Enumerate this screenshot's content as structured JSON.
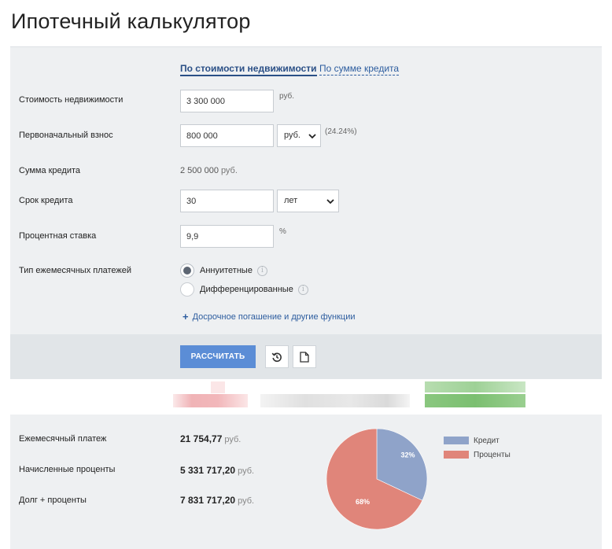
{
  "title": "Ипотечный калькулятор",
  "mode_tabs": {
    "by_property": "По стоимости недвижимости",
    "by_loan": "По сумме кредита"
  },
  "form": {
    "property_cost": {
      "label": "Стоимость недвижимости",
      "value": "3 300 000",
      "unit": "руб."
    },
    "down_payment": {
      "label": "Первоначальный взнос",
      "value": "800 000",
      "unit_selected": "руб.",
      "percent": "(24.24%)"
    },
    "loan_amount": {
      "label": "Сумма кредита",
      "value": "2 500 000",
      "unit": "руб."
    },
    "term": {
      "label": "Срок кредита",
      "value": "30",
      "unit_selected": "лет"
    },
    "rate": {
      "label": "Процентная ставка",
      "value": "9,9",
      "unit": "%"
    },
    "payment_type": {
      "label": "Тип ежемесячных платежей",
      "options": [
        "Аннуитетные",
        "Дифференцированные"
      ],
      "selected": "Аннуитетные"
    },
    "more_link": "Досрочное погашение и другие функции"
  },
  "actions": {
    "calculate": "РАССЧИТАТЬ",
    "reset_icon": "history-icon",
    "document_icon": "document-icon"
  },
  "results": {
    "monthly": {
      "label": "Ежемесячный платеж",
      "value": "21 754,77",
      "unit": "руб."
    },
    "interest": {
      "label": "Начисленные проценты",
      "value": "5 331 717,20",
      "unit": "руб."
    },
    "total": {
      "label": "Долг + проценты",
      "value": "7 831 717,20",
      "unit": "руб."
    }
  },
  "colors": {
    "accent": "#2a4f86",
    "button": "#5b8dd6",
    "credit": "#8fa3c9",
    "interest": "#e0857a"
  },
  "chart_data": {
    "type": "pie",
    "slices": [
      {
        "name": "Кредит",
        "value": 32,
        "label": "32%",
        "color": "#8fa3c9"
      },
      {
        "name": "Проценты",
        "value": 68,
        "label": "68%",
        "color": "#e0857a"
      }
    ],
    "legend_position": "right"
  }
}
